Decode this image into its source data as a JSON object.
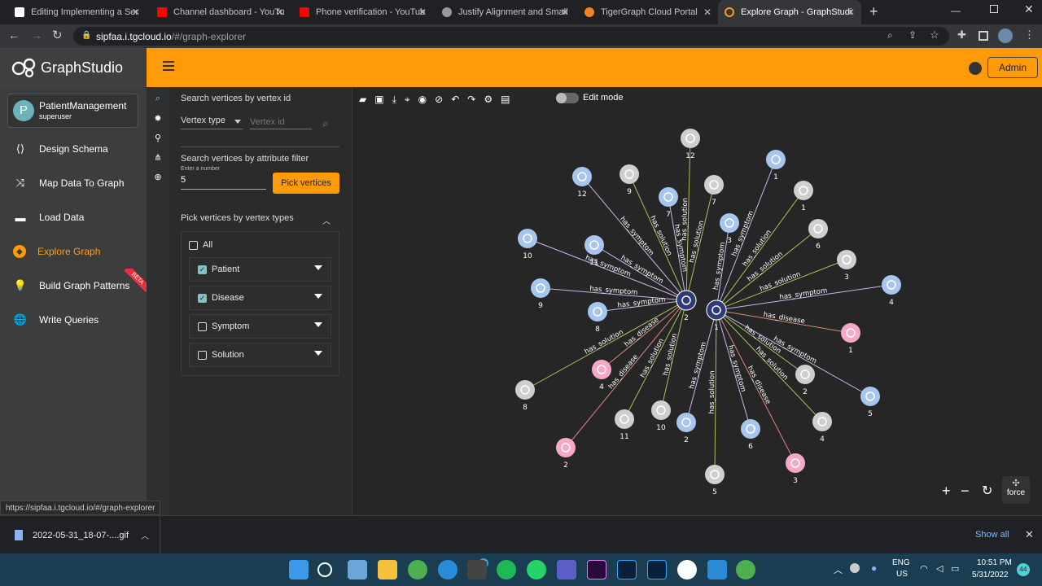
{
  "tabs": [
    {
      "label": "Editing Implementing a Ser"
    },
    {
      "label": "Channel dashboard - YouTu"
    },
    {
      "label": "Phone verification - YouTub"
    },
    {
      "label": "Justify Alignment and Small"
    },
    {
      "label": "TigerGraph Cloud Portal"
    },
    {
      "label": "Explore Graph - GraphStudi"
    }
  ],
  "address": {
    "host": "sipfaa.i.tgcloud.io",
    "path": "/#/graph-explorer"
  },
  "brand": "GraphStudio",
  "graph_selector": {
    "initial": "P",
    "name": "PatientManagement",
    "user": "superuser"
  },
  "nav": [
    {
      "label": "Design Schema",
      "icon": "share-icon"
    },
    {
      "label": "Map Data To Graph",
      "icon": "shuffle-icon"
    },
    {
      "label": "Load Data",
      "icon": "load-icon"
    },
    {
      "label": "Explore Graph",
      "icon": "compass-icon"
    },
    {
      "label": "Build Graph Patterns",
      "icon": "bulb-icon",
      "badge": "BETA"
    },
    {
      "label": "Write Queries",
      "icon": "globe-icon"
    }
  ],
  "header": {
    "admin_label": "Admin"
  },
  "panel": {
    "search_title": "Search vertices by vertex id",
    "vertex_type_label": "Vertex type",
    "vertex_id_placeholder": "Vertex id",
    "attr_title": "Search vertices by attribute filter",
    "number_hint": "Enter a number",
    "number_value": "5",
    "pick_button": "Pick vertices",
    "types_title": "Pick vertices by vertex types",
    "all_label": "All",
    "types": [
      {
        "label": "Patient",
        "checked": true
      },
      {
        "label": "Disease",
        "checked": true
      },
      {
        "label": "Symptom",
        "checked": false
      },
      {
        "label": "Solution",
        "checked": false
      }
    ]
  },
  "toolbar": {
    "edit_mode": "Edit mode"
  },
  "graph_controls": {
    "layout": "force"
  },
  "graph": {
    "nodes": [
      {
        "id": "d2",
        "type": "disease",
        "label": "2"
      },
      {
        "id": "d1",
        "type": "disease",
        "label": "1"
      },
      {
        "id": "n1",
        "type": "solution",
        "label": "12"
      },
      {
        "id": "n2",
        "type": "symptom",
        "label": "1"
      },
      {
        "id": "n3",
        "type": "symptom",
        "label": "12"
      },
      {
        "id": "n4",
        "type": "solution",
        "label": "9"
      },
      {
        "id": "n5",
        "type": "symptom",
        "label": "7"
      },
      {
        "id": "n6",
        "type": "solution",
        "label": "7"
      },
      {
        "id": "n7",
        "type": "solution",
        "label": "1"
      },
      {
        "id": "n8",
        "type": "symptom",
        "label": "3"
      },
      {
        "id": "n9",
        "type": "solution",
        "label": "6"
      },
      {
        "id": "n10",
        "type": "symptom",
        "label": "10"
      },
      {
        "id": "n11",
        "type": "symptom",
        "label": "11"
      },
      {
        "id": "n12",
        "type": "solution",
        "label": "3"
      },
      {
        "id": "n13",
        "type": "symptom",
        "label": "4"
      },
      {
        "id": "n14",
        "type": "symptom",
        "label": "9"
      },
      {
        "id": "n15",
        "type": "symptom",
        "label": "8"
      },
      {
        "id": "n16",
        "type": "patient",
        "label": "1"
      },
      {
        "id": "n17",
        "type": "solution",
        "label": "2"
      },
      {
        "id": "n18",
        "type": "patient",
        "label": "4"
      },
      {
        "id": "n19",
        "type": "solution",
        "label": "8"
      },
      {
        "id": "n20",
        "type": "symptom",
        "label": "5"
      },
      {
        "id": "n21",
        "type": "solution",
        "label": "11"
      },
      {
        "id": "n22",
        "type": "solution",
        "label": "10"
      },
      {
        "id": "n23",
        "type": "symptom",
        "label": "2"
      },
      {
        "id": "n24",
        "type": "symptom",
        "label": "6"
      },
      {
        "id": "n25",
        "type": "solution",
        "label": "4"
      },
      {
        "id": "n26",
        "type": "patient",
        "label": "2"
      },
      {
        "id": "n27",
        "type": "patient",
        "label": "3"
      },
      {
        "id": "n28",
        "type": "solution",
        "label": "5"
      }
    ],
    "edges": [
      {
        "from": "d2",
        "to": "n3",
        "label": "has_symptom"
      },
      {
        "from": "d2",
        "to": "n4",
        "label": "has_solution"
      },
      {
        "from": "d2",
        "to": "n5",
        "label": "has_symptom"
      },
      {
        "from": "d2",
        "to": "n6",
        "label": "has_solution"
      },
      {
        "from": "d2",
        "to": "n10",
        "label": "has_symptom"
      },
      {
        "from": "d2",
        "to": "n11",
        "label": "has_symptom"
      },
      {
        "from": "d2",
        "to": "n14",
        "label": "has_symptom"
      },
      {
        "from": "d2",
        "to": "n15",
        "label": "has_symptom"
      },
      {
        "from": "d2",
        "to": "n19",
        "label": "has_solution"
      },
      {
        "from": "d2",
        "to": "n18",
        "label": "has_disease"
      },
      {
        "from": "d2",
        "to": "n26",
        "label": "has_disease"
      },
      {
        "from": "d2",
        "to": "n21",
        "label": "has_solution"
      },
      {
        "from": "d2",
        "to": "n22",
        "label": "has_solution"
      },
      {
        "from": "d2",
        "to": "n1",
        "label": "has_solution"
      },
      {
        "from": "d1",
        "to": "n8",
        "label": "has_symptom"
      },
      {
        "from": "d1",
        "to": "n7",
        "label": "has_solution"
      },
      {
        "from": "d1",
        "to": "n2",
        "label": "has_symptom"
      },
      {
        "from": "d1",
        "to": "n9",
        "label": "has_solution"
      },
      {
        "from": "d1",
        "to": "n12",
        "label": "has_solution"
      },
      {
        "from": "d1",
        "to": "n13",
        "label": "has_symptom"
      },
      {
        "from": "d1",
        "to": "n16",
        "label": "has_disease"
      },
      {
        "from": "d1",
        "to": "n17",
        "label": "has_solution"
      },
      {
        "from": "d1",
        "to": "n20",
        "label": "has_symptom"
      },
      {
        "from": "d1",
        "to": "n25",
        "label": "has_solution"
      },
      {
        "from": "d1",
        "to": "n27",
        "label": "has_disease"
      },
      {
        "from": "d1",
        "to": "n24",
        "label": "has_symptom"
      },
      {
        "from": "d1",
        "to": "n28",
        "label": "has_solution"
      },
      {
        "from": "d1",
        "to": "n23",
        "label": "has_symptom"
      }
    ]
  },
  "status_url": "https://sipfaa.i.tgcloud.io/#/graph-explorer",
  "download": {
    "filename": "2022-05-31_18-07-....gif",
    "show_all": "Show all"
  },
  "taskbar": {
    "lang": "ENG",
    "region": "US",
    "time": "10:51 PM",
    "date": "5/31/2022",
    "badge": "44",
    "teams_badge": "16"
  },
  "colors": {
    "accent": "#ff9a08",
    "patient": "#f7a8c8",
    "symptom": "#a6c6ef",
    "solution": "#cfcfcf",
    "disease": "#2f3a78",
    "edge_symptom": "#c9b6e8",
    "edge_solution": "#a8c25a",
    "edge_disease": "#d88a7a"
  }
}
